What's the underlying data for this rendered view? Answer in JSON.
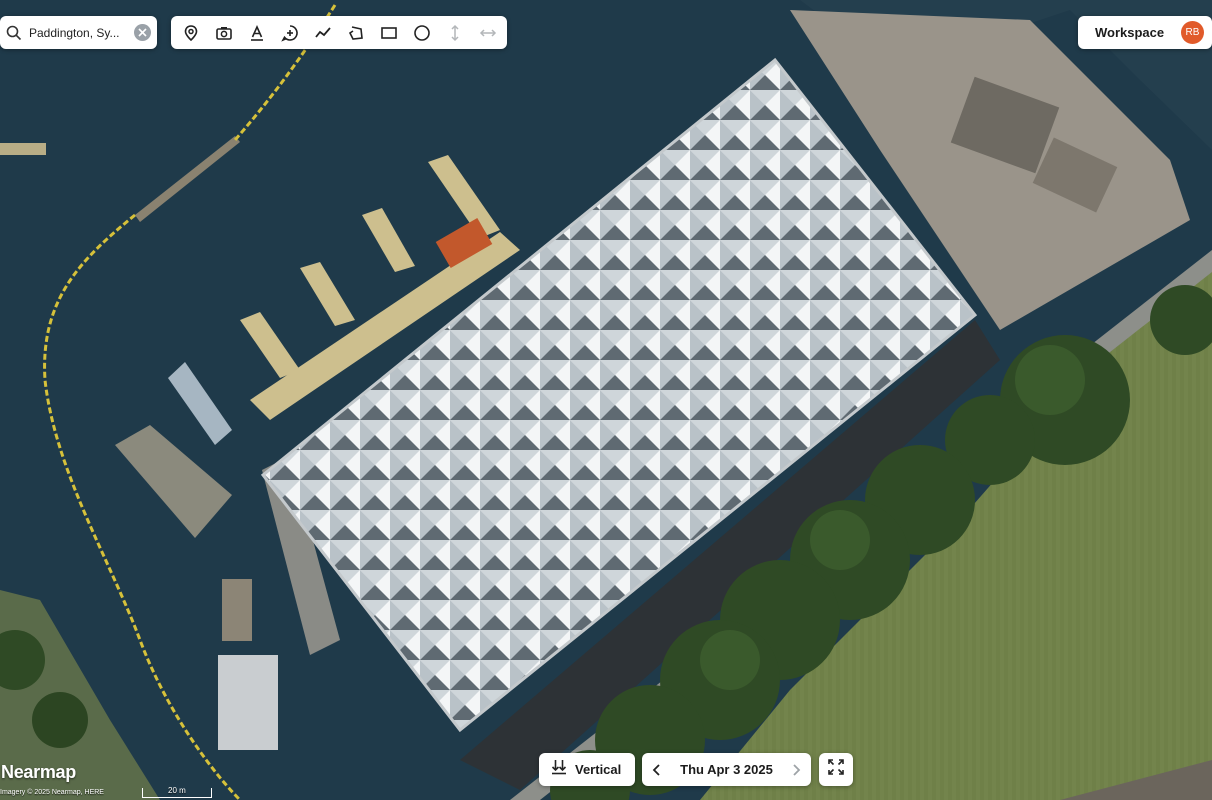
{
  "search": {
    "value": "Paddington, Sy...",
    "icon": "search-icon",
    "clear_icon": "clear-icon"
  },
  "toolbar": {
    "tools": [
      {
        "icon": "location-pin-icon"
      },
      {
        "icon": "camera-icon"
      },
      {
        "icon": "text-icon"
      },
      {
        "icon": "add-comment-icon"
      },
      {
        "icon": "polyline-icon"
      },
      {
        "icon": "polygon-icon"
      },
      {
        "icon": "rectangle-icon"
      },
      {
        "icon": "circle-icon"
      },
      {
        "icon": "vertical-measure-icon"
      },
      {
        "icon": "horizontal-measure-icon"
      }
    ]
  },
  "workspace": {
    "label": "Workspace",
    "avatar_initials": "RB",
    "avatar_color": "#e15a2a"
  },
  "view_mode": {
    "label": "Vertical",
    "icon": "vertical-view-icon"
  },
  "date_nav": {
    "label": "Thu Apr 3 2025",
    "prev_icon": "chevron-left-icon",
    "next_icon": "chevron-right-icon"
  },
  "fullscreen": {
    "icon": "fullscreen-icon"
  },
  "map": {
    "brand": "Nearmap",
    "attribution": "Imagery © 2025 Nearmap, HERE",
    "scale_label": "20 m",
    "colors": {
      "water": "#1f3a4a",
      "grass": "#6e7f45",
      "trees": "#2f4a25",
      "roof": "#d7dde0"
    }
  }
}
